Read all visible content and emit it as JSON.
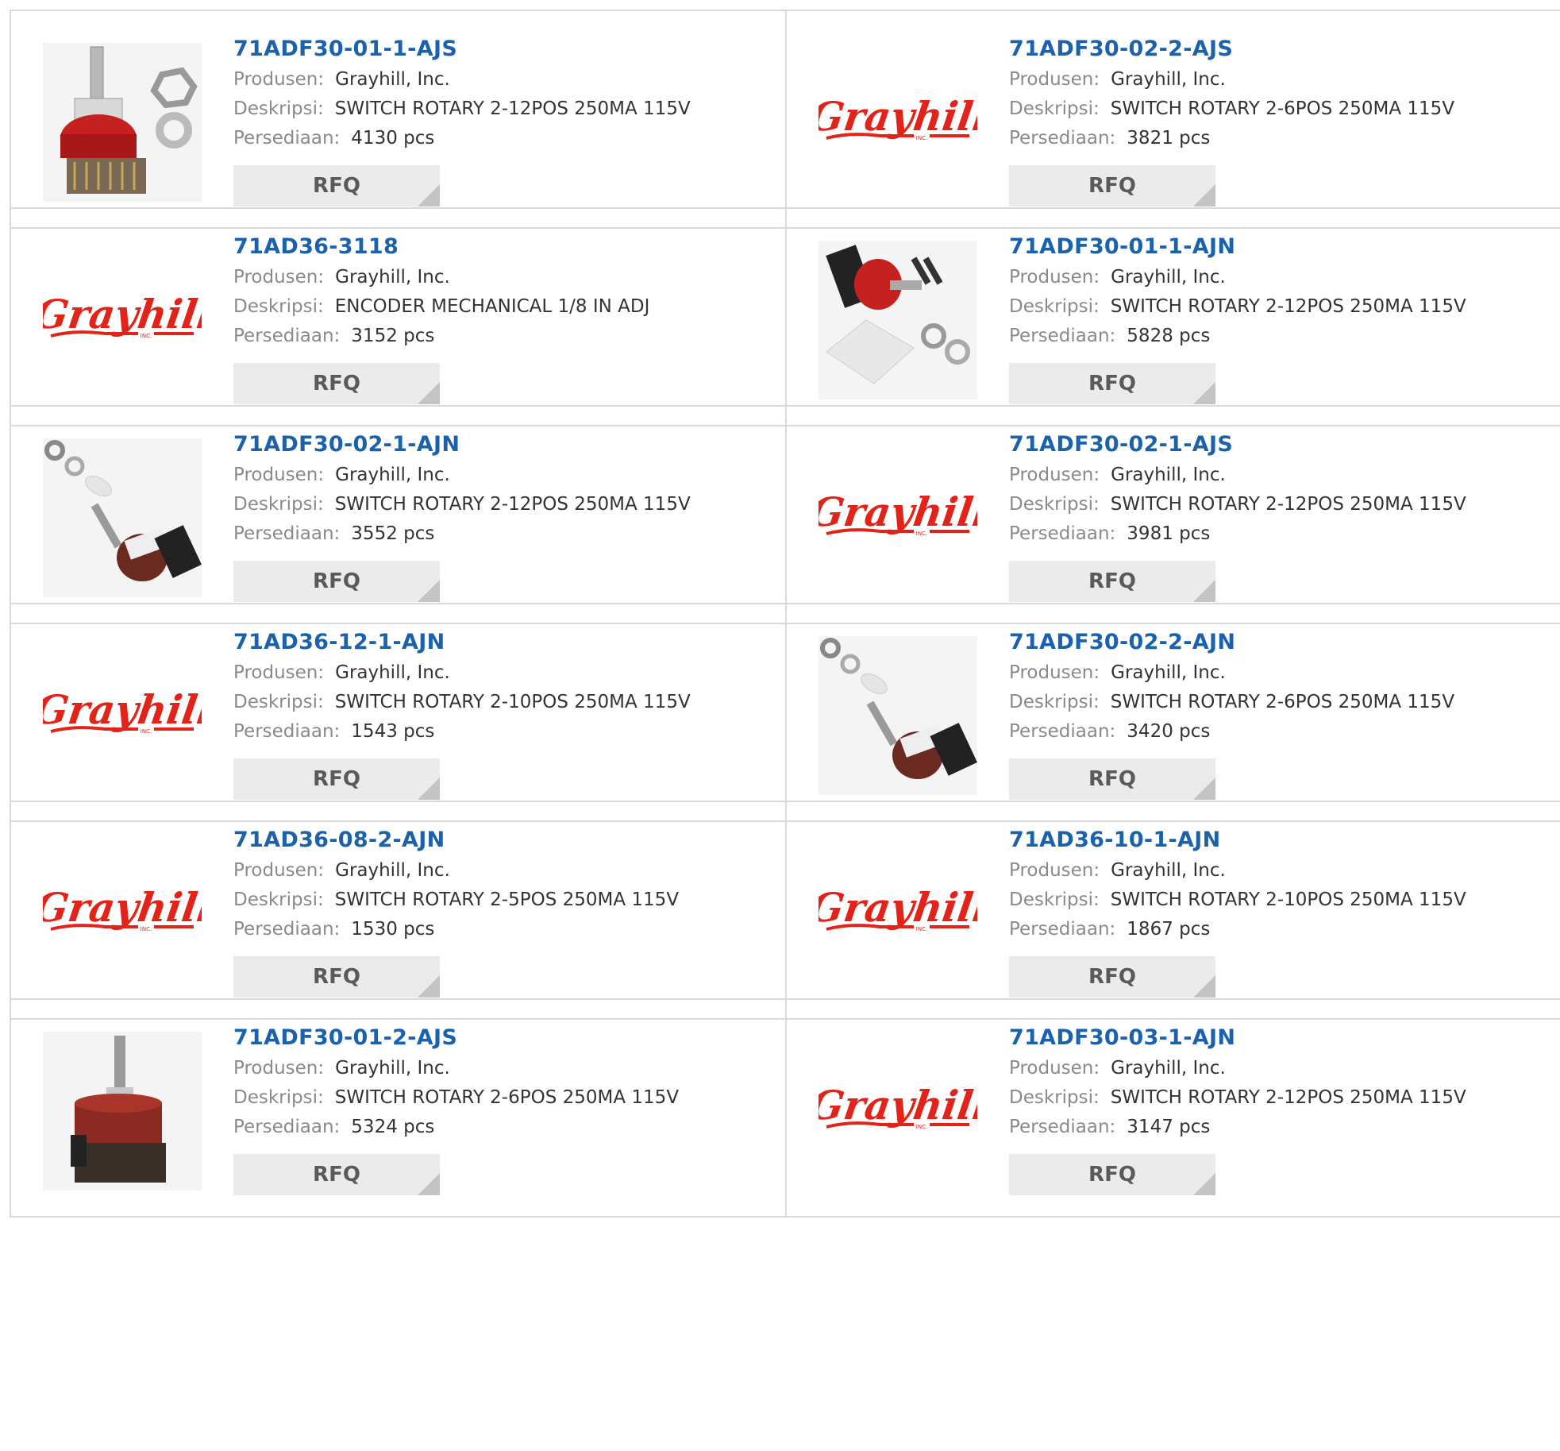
{
  "labels": {
    "manufacturer": "Produsen:",
    "description": "Deskripsi:",
    "stock": "Persediaan:",
    "rfq": "RFQ"
  },
  "logo_text": "Grayhill",
  "logo_sub": "INC.",
  "products": [
    {
      "part": "71ADF30-01-1-AJS",
      "manufacturer": "Grayhill, Inc.",
      "description": "SWITCH ROTARY 2-12POS 250MA 115V",
      "stock": "4130 pcs",
      "image": "rotary-switch-photo-upright"
    },
    {
      "part": "71ADF30-02-2-AJS",
      "manufacturer": "Grayhill, Inc.",
      "description": "SWITCH ROTARY 2-6POS 250MA 115V",
      "stock": "3821 pcs",
      "image": "grayhill-logo"
    },
    {
      "part": "71AD36-3118",
      "manufacturer": "Grayhill, Inc.",
      "description": "ENCODER MECHANICAL 1/8 IN ADJ",
      "stock": "3152 pcs",
      "image": "grayhill-logo"
    },
    {
      "part": "71ADF30-01-1-AJN",
      "manufacturer": "Grayhill, Inc.",
      "description": "SWITCH ROTARY 2-12POS 250MA 115V",
      "stock": "5828 pcs",
      "image": "rotary-switch-photo-kit"
    },
    {
      "part": "71ADF30-02-1-AJN",
      "manufacturer": "Grayhill, Inc.",
      "description": "SWITCH ROTARY 2-12POS 250MA 115V",
      "stock": "3552 pcs",
      "image": "rotary-switch-photo-angled"
    },
    {
      "part": "71ADF30-02-1-AJS",
      "manufacturer": "Grayhill, Inc.",
      "description": "SWITCH ROTARY 2-12POS 250MA 115V",
      "stock": "3981 pcs",
      "image": "grayhill-logo"
    },
    {
      "part": "71AD36-12-1-AJN",
      "manufacturer": "Grayhill, Inc.",
      "description": "SWITCH ROTARY 2-10POS 250MA 115V",
      "stock": "1543 pcs",
      "image": "grayhill-logo"
    },
    {
      "part": "71ADF30-02-2-AJN",
      "manufacturer": "Grayhill, Inc.",
      "description": "SWITCH ROTARY 2-6POS 250MA 115V",
      "stock": "3420 pcs",
      "image": "rotary-switch-photo-angled"
    },
    {
      "part": "71AD36-08-2-AJN",
      "manufacturer": "Grayhill, Inc.",
      "description": "SWITCH ROTARY 2-5POS 250MA 115V",
      "stock": "1530 pcs",
      "image": "grayhill-logo"
    },
    {
      "part": "71AD36-10-1-AJN",
      "manufacturer": "Grayhill, Inc.",
      "description": "SWITCH ROTARY 2-10POS 250MA 115V",
      "stock": "1867 pcs",
      "image": "grayhill-logo"
    },
    {
      "part": "71ADF30-01-2-AJS",
      "manufacturer": "Grayhill, Inc.",
      "description": "SWITCH ROTARY 2-6POS 250MA 115V",
      "stock": "5324 pcs",
      "image": "rotary-switch-photo-tall"
    },
    {
      "part": "71ADF30-03-1-AJN",
      "manufacturer": "Grayhill, Inc.",
      "description": "SWITCH ROTARY 2-12POS 250MA 115V",
      "stock": "3147 pcs",
      "image": "grayhill-logo"
    }
  ],
  "colors": {
    "link": "#1b62ad",
    "logo_red": "#e2231a",
    "button_bg": "#ebebeb",
    "border": "#d9d9d9"
  }
}
